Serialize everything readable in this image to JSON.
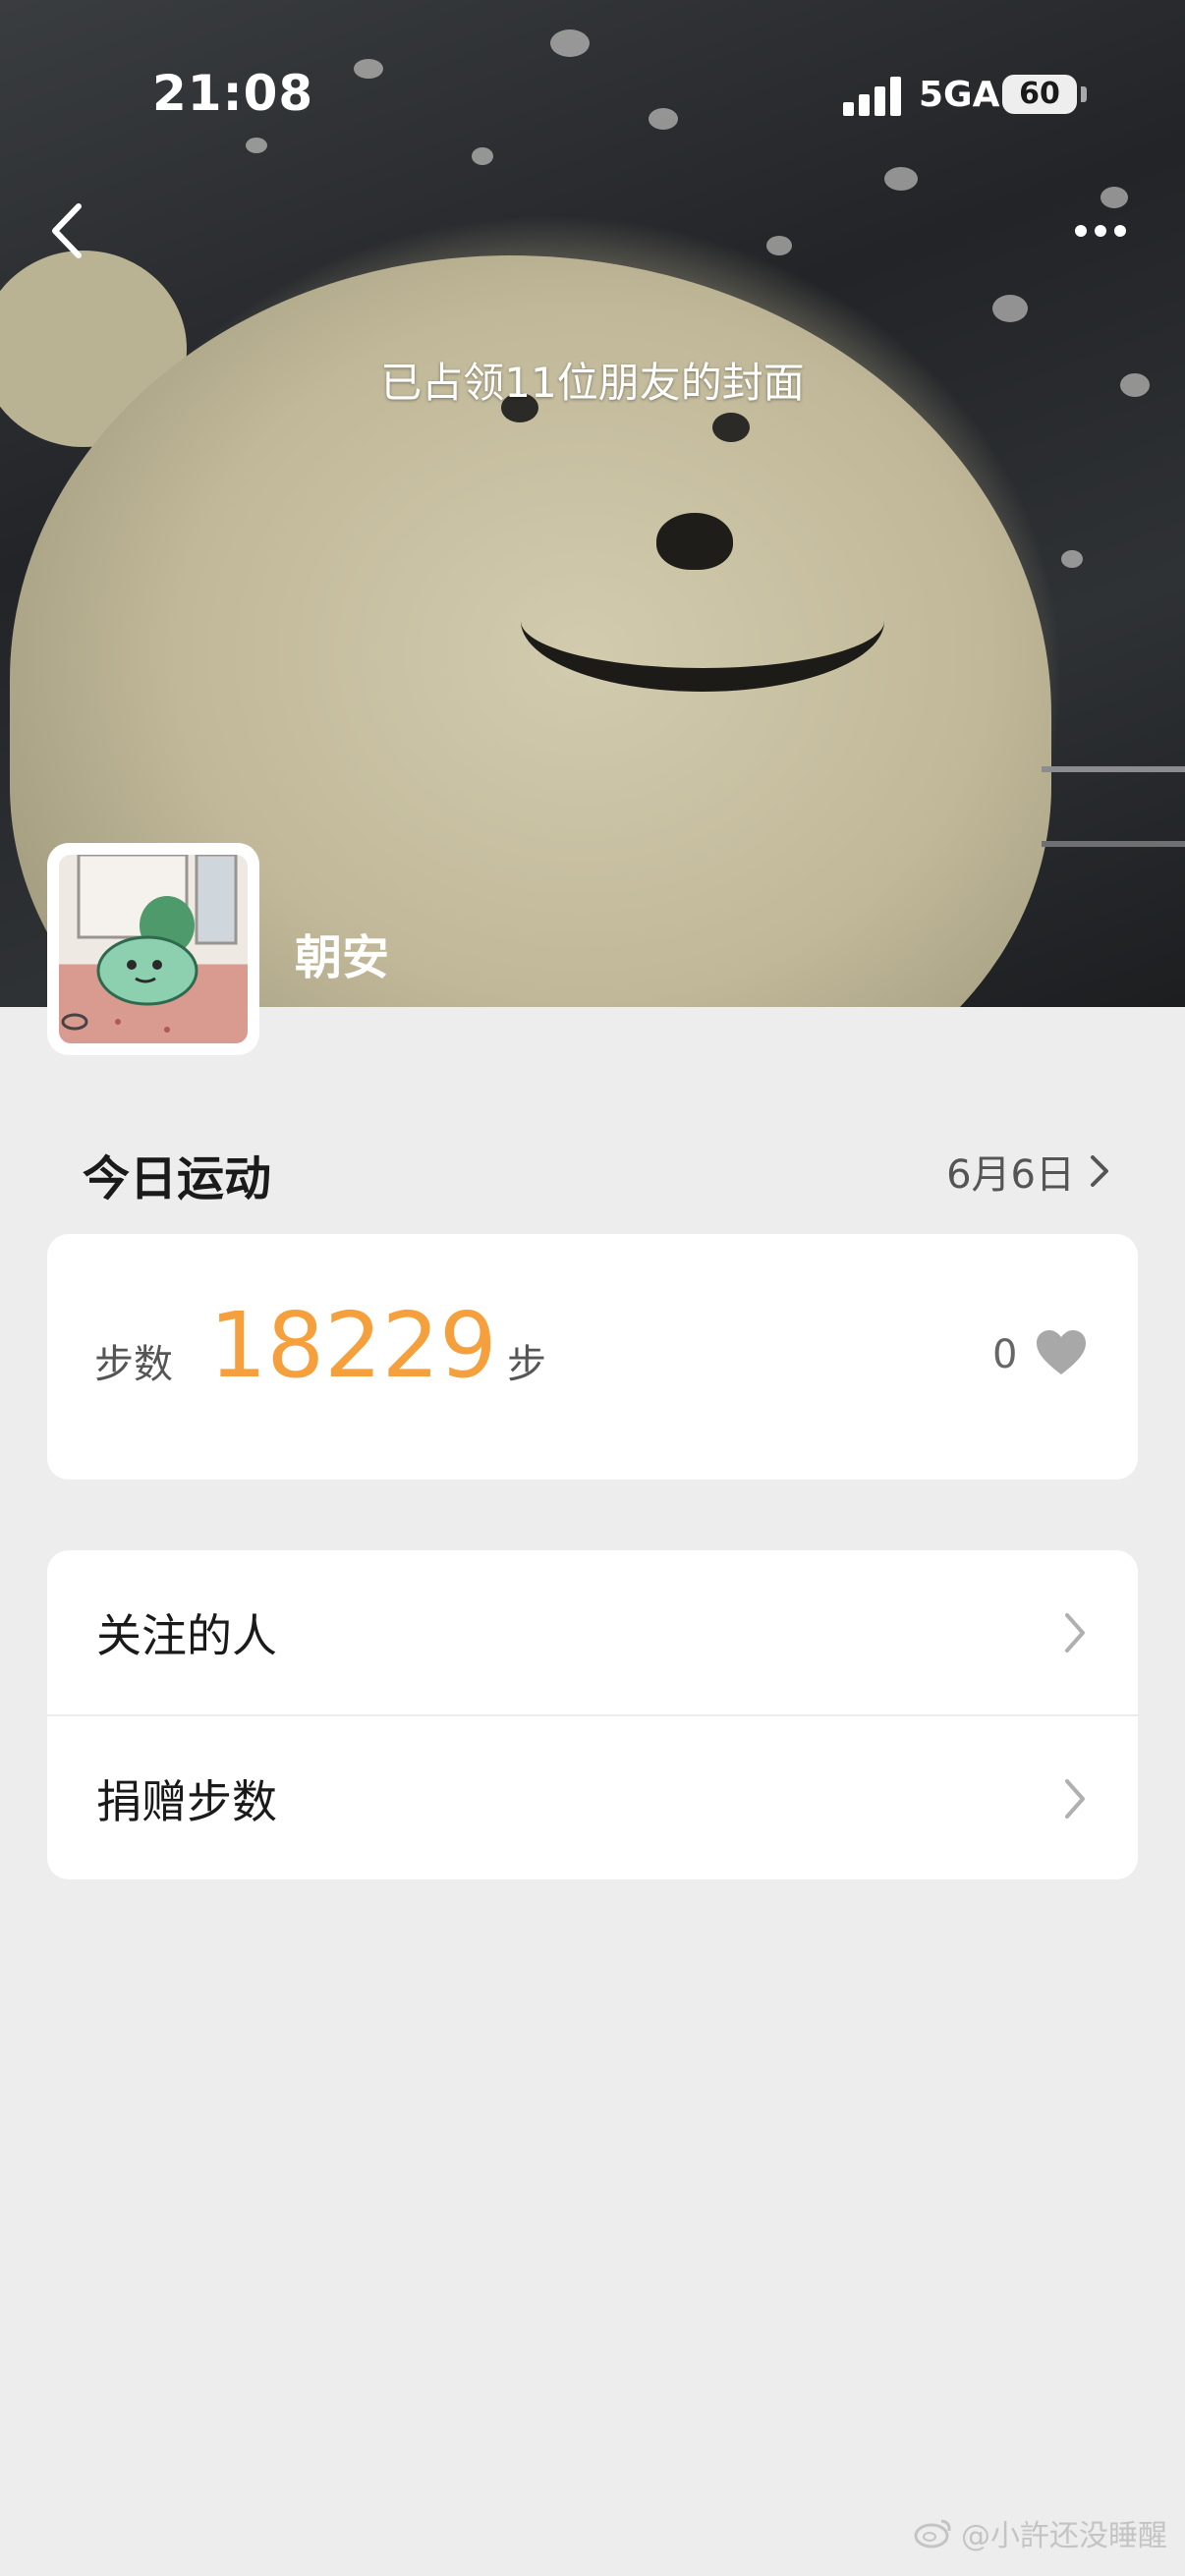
{
  "status_bar": {
    "time": "21:08",
    "network": "5GA",
    "battery": "60"
  },
  "cover": {
    "caption": "已占领11位朋友的封面"
  },
  "profile": {
    "name": "朝安"
  },
  "today": {
    "section_title": "今日运动",
    "date": "6月6日"
  },
  "steps": {
    "label": "步数",
    "value": "18229",
    "unit": "步",
    "likes": "0"
  },
  "menu": {
    "items": [
      {
        "label": "关注的人"
      },
      {
        "label": "捐赠步数"
      }
    ]
  },
  "watermark": {
    "text": "@小許还没睡醒"
  },
  "icons": {
    "back": "chevron-left-icon",
    "more": "more-dots-icon",
    "date_arrow": "chevron-right-icon",
    "like": "heart-icon",
    "menu_arrow": "chevron-right-icon",
    "watermark": "weibo-icon"
  },
  "colors": {
    "steps_value": "#f5a03c",
    "background": "#ededed",
    "card": "#ffffff"
  }
}
